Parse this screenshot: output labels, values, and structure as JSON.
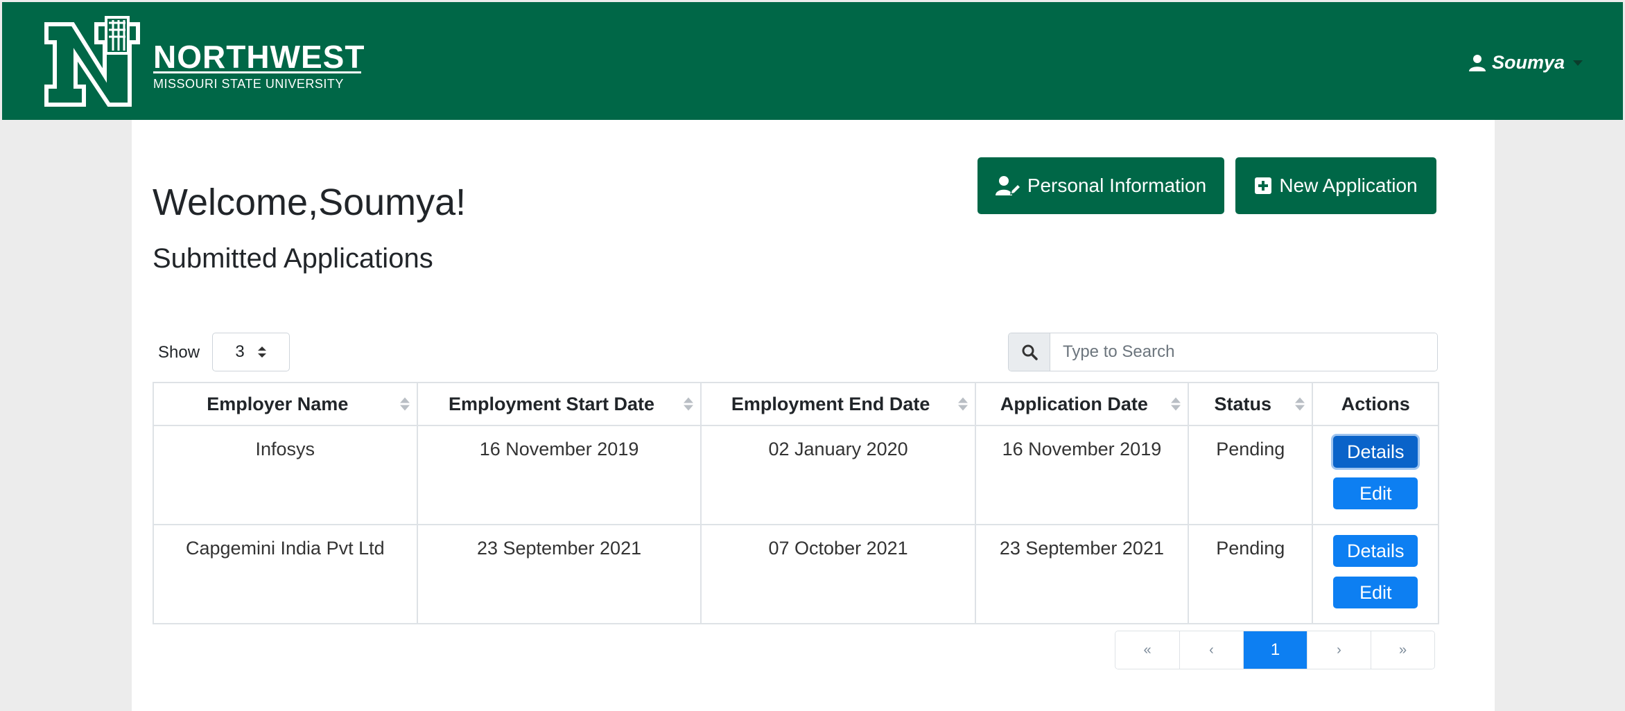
{
  "header": {
    "brand_word": "NORTHWEST",
    "brand_sub": "MISSOURI STATE UNIVERSITY",
    "user_name": "Soumya"
  },
  "main": {
    "welcome": "Welcome,Soumya!",
    "subtitle": "Submitted Applications",
    "personal_info_label": "Personal Information",
    "new_application_label": "New Application",
    "show_label": "Show",
    "show_value": "3",
    "search_placeholder": "Type to Search"
  },
  "table": {
    "headers": [
      "Employer Name",
      "Employment Start Date",
      "Employment End Date",
      "Application Date",
      "Status",
      "Actions"
    ],
    "rows": [
      {
        "employer": "Infosys",
        "start": "16 November 2019",
        "end": "02 January 2020",
        "applied": "16 November 2019",
        "status": "Pending",
        "details": "Details",
        "edit": "Edit"
      },
      {
        "employer": "Capgemini India Pvt Ltd",
        "start": "23 September 2021",
        "end": "07 October 2021",
        "applied": "23 September 2021",
        "status": "Pending",
        "details": "Details",
        "edit": "Edit"
      }
    ]
  },
  "pagination": {
    "first": "«",
    "prev": "‹",
    "current": "1",
    "next": "›",
    "last": "»"
  },
  "colors": {
    "brand_green": "#006747",
    "primary_blue": "#0d7ff2"
  }
}
